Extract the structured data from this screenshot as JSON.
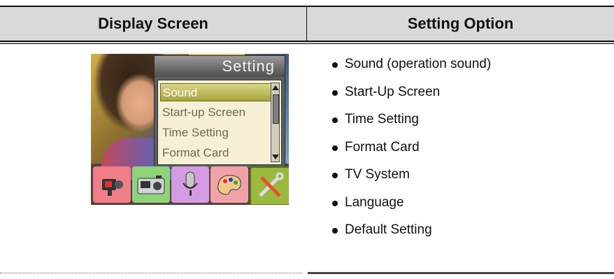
{
  "table": {
    "headers": [
      "Display Screen",
      "Setting Option"
    ]
  },
  "screen": {
    "menu_title": "Setting",
    "menu_items": [
      "Sound",
      "Start-up Screen",
      "Time Setting",
      "Format Card"
    ],
    "selected_index": 0,
    "icons": [
      "camcorder-icon",
      "camera-icon",
      "microphone-icon",
      "palette-icon",
      "tools-icon"
    ]
  },
  "options": [
    "Sound (operation sound)",
    "Start-Up Screen",
    "Time Setting",
    "Format Card",
    "TV System",
    "Language",
    "Default Setting"
  ]
}
